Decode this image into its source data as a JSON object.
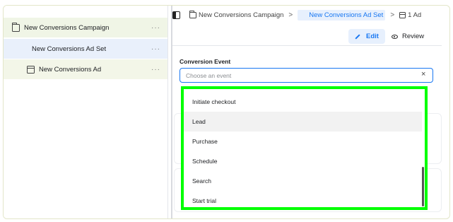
{
  "tree": {
    "campaign": {
      "label": "New Conversions Campaign",
      "more": "···"
    },
    "adset": {
      "label": "New Conversions Ad Set",
      "more": "···"
    },
    "ad": {
      "label": "New Conversions Ad",
      "more": "···"
    }
  },
  "breadcrumb": {
    "campaign": "New Conversions Campaign",
    "adset": "New Conversions Ad Set",
    "ad": "1 Ad",
    "separator": ">"
  },
  "actions": {
    "edit": "Edit",
    "review": "Review"
  },
  "conversion_event": {
    "label": "Conversion Event",
    "placeholder": "Choose an event",
    "value": "",
    "clear": "×"
  },
  "dropdown": {
    "options": [
      "Initiate checkout",
      "Lead",
      "Purchase",
      "Schedule",
      "Search",
      "Start trial"
    ],
    "hovered": "Lead"
  },
  "colors": {
    "accent": "#1877f2",
    "highlight_border": "#00ff00",
    "adset_row_bg": "#e9f0fb",
    "campaign_row_bg": "#f0f5e6"
  }
}
